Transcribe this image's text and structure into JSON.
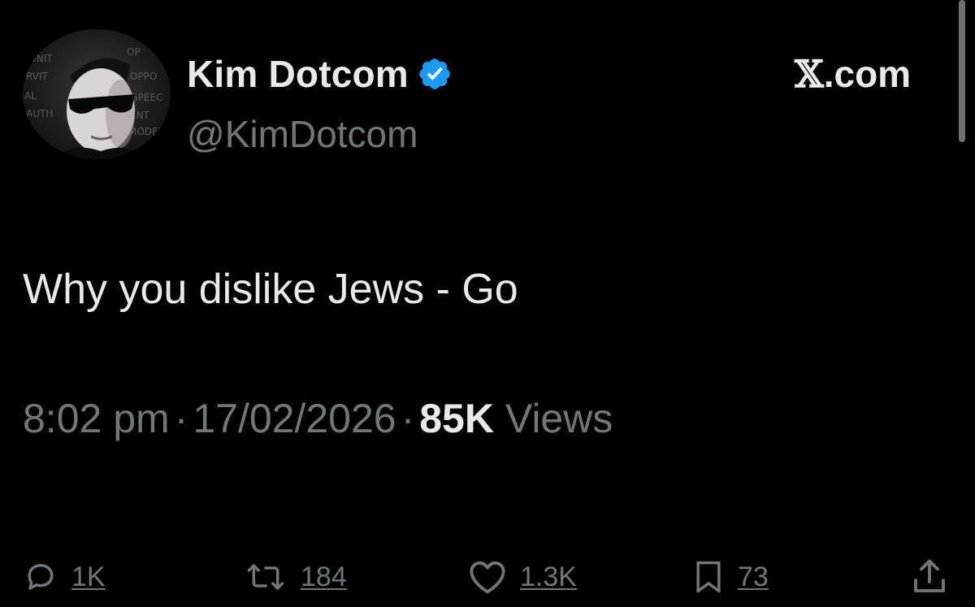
{
  "author": {
    "display_name": "Kim Dotcom",
    "handle": "@KimDotcom",
    "verified": true,
    "verified_color": "#1d9bf0"
  },
  "brand": {
    "x_glyph": "𝕏",
    "suffix": ".com"
  },
  "tweet": {
    "text": "Why you dislike Jews - Go"
  },
  "meta": {
    "time": "8:02 pm",
    "separator": "·",
    "date": "17/02/2026",
    "views_count": "85K",
    "views_label": "Views"
  },
  "actions": {
    "replies": {
      "icon": "reply-icon",
      "count": "1K"
    },
    "reposts": {
      "icon": "repost-icon",
      "count": "184"
    },
    "likes": {
      "icon": "like-icon",
      "count": "1.3K"
    },
    "bookmarks": {
      "icon": "bookmark-icon",
      "count": "73"
    },
    "share": {
      "icon": "share-icon"
    }
  },
  "colors": {
    "background": "#000000",
    "primary_text": "#e7e9ea",
    "secondary_text": "#71767b"
  }
}
